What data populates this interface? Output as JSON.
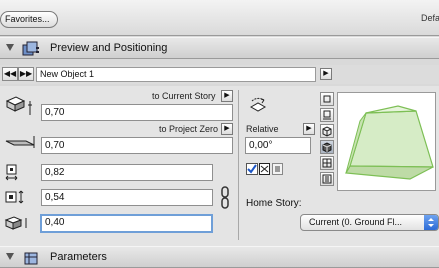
{
  "toolbar": {
    "favorites_label": "Favorites...",
    "right_label": "Defa"
  },
  "section_preview": {
    "title": "Preview and Positioning"
  },
  "object": {
    "name": "New Object 1"
  },
  "fields": {
    "to_current_story_label": "to Current Story",
    "to_current_story_value": "0,70",
    "to_project_zero_label": "to Project Zero",
    "to_project_zero_value": "0,70",
    "width_value": "0,82",
    "depth_value": "0,54",
    "height_value": "0,40"
  },
  "relative": {
    "label": "Relative",
    "value": "0,00°"
  },
  "home_story": {
    "label": "Home Story:",
    "selected": "Current (0. Ground Fl..."
  },
  "section_parameters": {
    "title": "Parameters"
  }
}
